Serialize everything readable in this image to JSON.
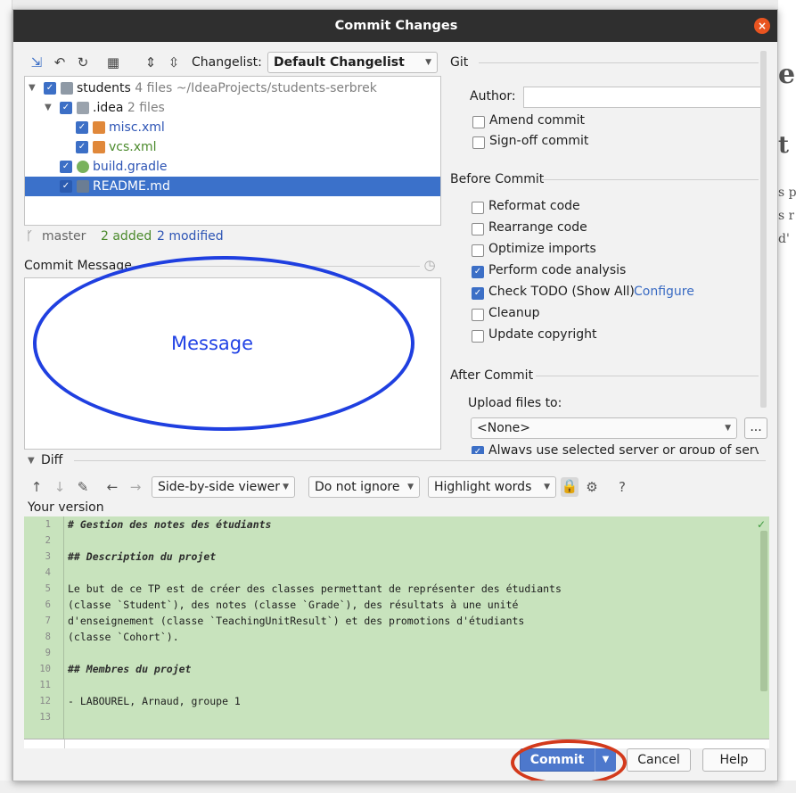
{
  "background": {
    "right_glyphs": [
      "e",
      "t",
      "s p",
      "s r",
      "d'"
    ]
  },
  "dialog": {
    "title": "Commit Changes",
    "close_glyph": "×"
  },
  "toolbar": {
    "changelist_label": "Changelist:",
    "changelist_value": "Default Changelist"
  },
  "tree": {
    "items": [
      {
        "name": "students",
        "meta": "4 files  ~/IdeaProjects/students-serbrek"
      },
      {
        "name": ".idea",
        "meta": "2 files"
      },
      {
        "name": "misc.xml",
        "meta": ""
      },
      {
        "name": "vcs.xml",
        "meta": ""
      },
      {
        "name": "build.gradle",
        "meta": ""
      },
      {
        "name": "README.md",
        "meta": ""
      }
    ]
  },
  "status": {
    "branch": "master",
    "added": "2 added",
    "modified": "2 modified"
  },
  "commit_message": {
    "label": "Commit Message",
    "annotation": "Message"
  },
  "git": {
    "section": "Git",
    "author_label": "Author:",
    "author_value": "",
    "amend": "Amend commit",
    "signoff": "Sign-off commit"
  },
  "before_commit": {
    "section": "Before Commit",
    "options": [
      {
        "label": "Reformat code",
        "checked": false
      },
      {
        "label": "Rearrange code",
        "checked": false
      },
      {
        "label": "Optimize imports",
        "checked": false
      },
      {
        "label": "Perform code analysis",
        "checked": true
      },
      {
        "label": "Check TODO (Show All)",
        "checked": true
      },
      {
        "label": "Cleanup",
        "checked": false
      },
      {
        "label": "Update copyright",
        "checked": false
      }
    ],
    "configure_link": "Configure"
  },
  "after_commit": {
    "section": "After Commit",
    "upload_label": "Upload files to:",
    "upload_value": "<None>",
    "browse": "...",
    "always_use": "Always use selected server or group of servers"
  },
  "diff": {
    "label": "Diff",
    "viewer": "Side-by-side viewer",
    "ignore": "Do not ignore",
    "highlight": "Highlight words",
    "help": "?",
    "your_version": "Your version",
    "lines": [
      "# Gestion des notes des étudiants",
      "",
      "## Description du projet",
      "",
      "Le but de ce TP est de créer des classes permettant de représenter des étudiants",
      "(classe `Student`), des notes (classe `Grade`), des résultats à une unité",
      "d'enseignement (classe `TeachingUnitResult`) et des promotions d'étudiants",
      "(classe `Cohort`).",
      "",
      "## Membres du projet",
      "",
      "- LABOUREL, Arnaud, groupe 1",
      ""
    ],
    "line_numbers": [
      "1",
      "2",
      "3",
      "4",
      "5",
      "6",
      "7",
      "8",
      "9",
      "10",
      "11",
      "12",
      "13"
    ]
  },
  "buttons": {
    "commit": "Commit",
    "cancel": "Cancel",
    "help": "Help"
  }
}
